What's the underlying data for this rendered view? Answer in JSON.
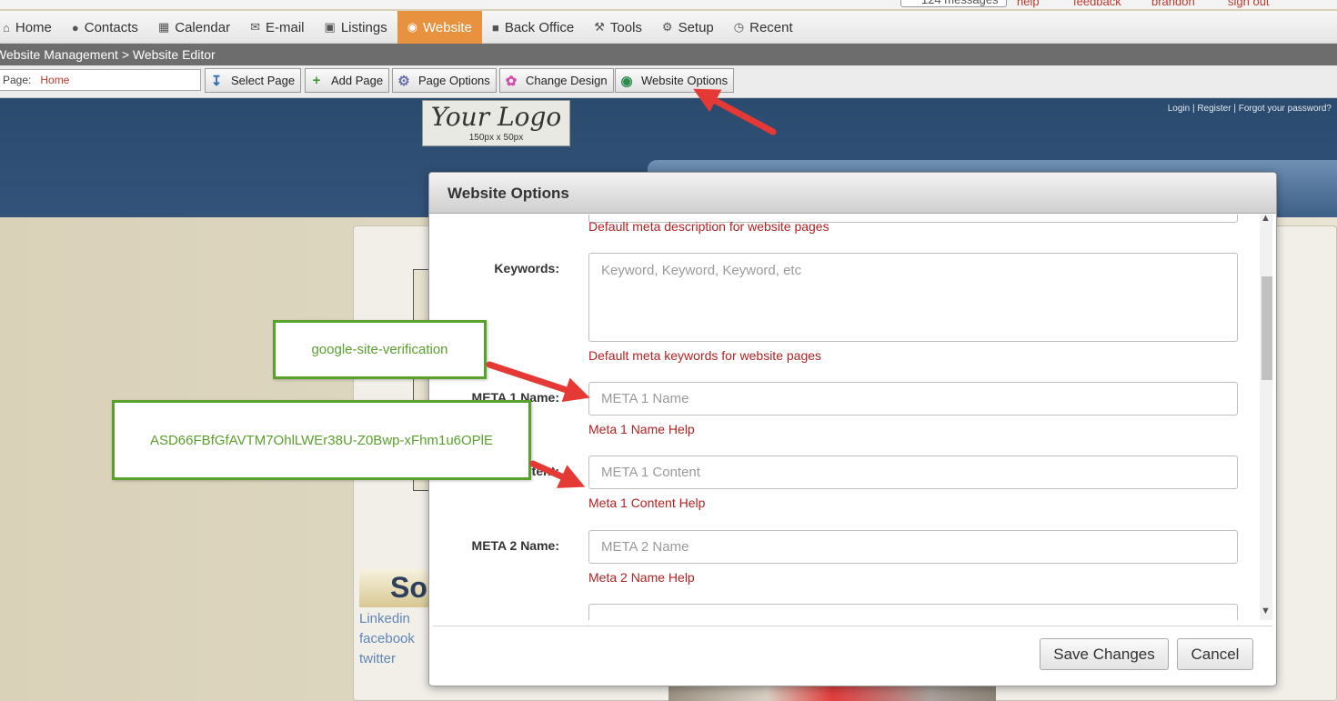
{
  "status": {
    "messages": "124 messages",
    "help": "help",
    "feedback": "feedback",
    "user": "brandon",
    "signout": "sign out"
  },
  "nav": {
    "items": [
      {
        "label": "Home",
        "icon": "home-icon"
      },
      {
        "label": "Contacts",
        "icon": "person-icon"
      },
      {
        "label": "Calendar",
        "icon": "calendar-icon"
      },
      {
        "label": "E-mail",
        "icon": "envelope-icon"
      },
      {
        "label": "Listings",
        "icon": "picture-icon"
      },
      {
        "label": "Website",
        "icon": "globe-icon",
        "active": true
      },
      {
        "label": "Back Office",
        "icon": "briefcase-icon"
      },
      {
        "label": "Tools",
        "icon": "wrench-icon"
      },
      {
        "label": "Setup",
        "icon": "gear-icon"
      },
      {
        "label": "Recent",
        "icon": "clock-icon"
      }
    ]
  },
  "breadcrumb": "Website Management > Website Editor",
  "toolbar": {
    "page_label": "Page:",
    "page_value": "Home",
    "select_page": "Select Page",
    "add_page": "Add Page",
    "page_options": "Page Options",
    "change_design": "Change Design",
    "website_options": "Website Options"
  },
  "site": {
    "logo_text": "Your Logo",
    "logo_size": "150px x 50px",
    "auth_links": "Login | Register | Forgot your password?",
    "social_heading": "So",
    "social_links": [
      "Linkedin",
      "facebook",
      "twitter"
    ]
  },
  "modal": {
    "title": "Website Options",
    "description_help": "Default meta description for website pages",
    "keywords_label": "Keywords:",
    "keywords_placeholder": "Keyword, Keyword, Keyword, etc",
    "keywords_help": "Default meta keywords for website pages",
    "meta1_name_label": "META 1 Name:",
    "meta1_name_placeholder": "META 1 Name",
    "meta1_name_help": "Meta 1 Name Help",
    "meta1_content_label": "META 1 Content:",
    "meta1_content_placeholder": "META 1 Content",
    "meta1_content_help": "Meta 1 Content Help",
    "meta2_name_label": "META 2 Name:",
    "meta2_name_placeholder": "META 2 Name",
    "meta2_name_help": "Meta 2 Name Help",
    "save_label": "Save Changes",
    "cancel_label": "Cancel"
  },
  "annotations": {
    "callout_name": "google-site-verification",
    "callout_content": "ASD66FBfGfAVTM7OhlLWEr38U-Z0Bwp-xFhm1u6OPlE"
  },
  "colors": {
    "accent": "#e8913f",
    "help_text": "#b22222",
    "callout": "#5aa02c",
    "arrow": "#e53935",
    "header": "#2a4a6e"
  }
}
